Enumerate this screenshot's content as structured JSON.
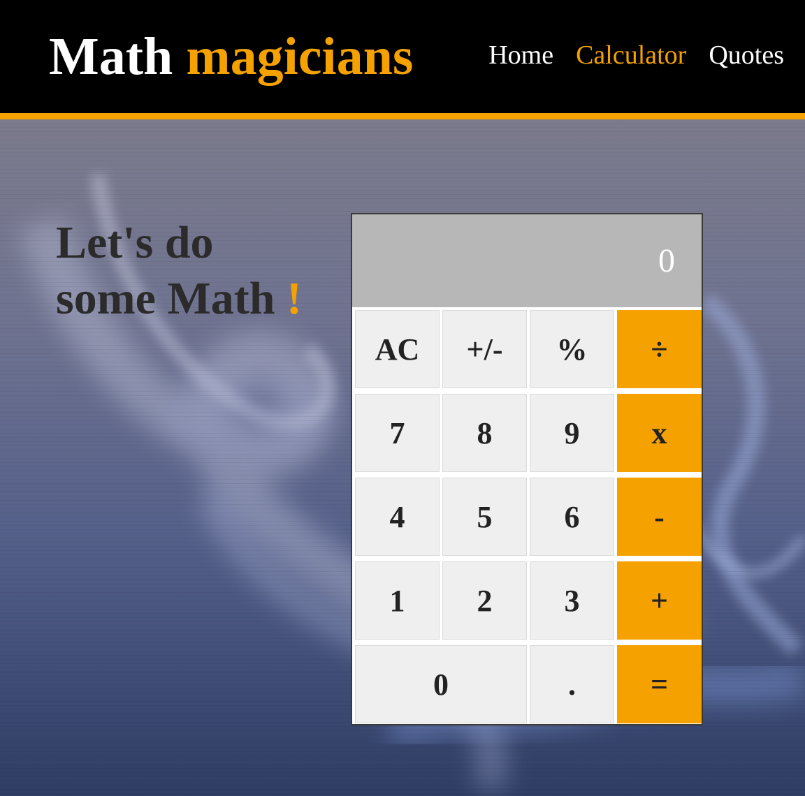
{
  "header": {
    "logo_part1": "Math",
    "logo_part2": "magicians",
    "nav": {
      "home": "Home",
      "calculator": "Calculator",
      "quotes": "Quotes"
    },
    "active_nav": "Calculator"
  },
  "hero": {
    "line1": "Let's do",
    "line2": "some Math",
    "exclamation": "!"
  },
  "calculator": {
    "display": "0",
    "keys": {
      "ac": "AC",
      "sign": "+/-",
      "percent": "%",
      "divide": "÷",
      "seven": "7",
      "eight": "8",
      "nine": "9",
      "multiply": "x",
      "four": "4",
      "five": "5",
      "six": "6",
      "minus": "-",
      "one": "1",
      "two": "2",
      "three": "3",
      "plus": "+",
      "zero": "0",
      "dot": ".",
      "equals": "="
    }
  },
  "colors": {
    "accent": "#f5a200",
    "header_bg": "#000000",
    "display_bg": "#b7b7b7",
    "key_bg": "#efefef"
  }
}
